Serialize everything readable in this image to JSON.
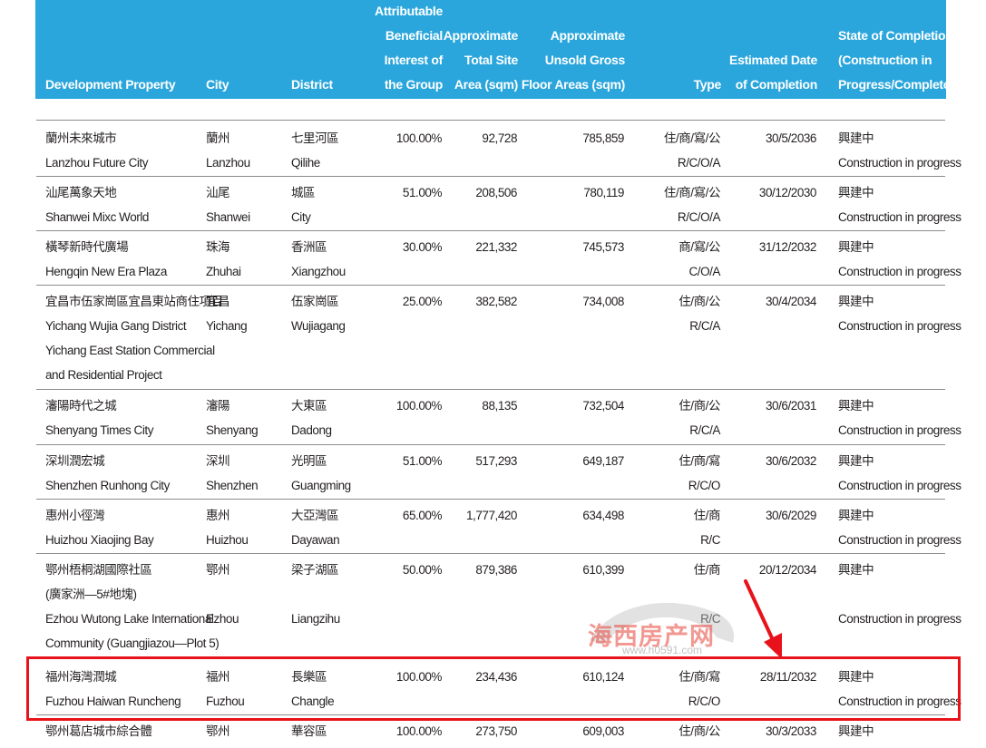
{
  "headers": {
    "property": "Development Property",
    "city": "City",
    "district": "District",
    "interest": "Attributable\nBeneficial\nInterest of\nthe Group",
    "site_area": "Approximate\nTotal Site\nArea (sqm)",
    "gfa": "Approximate\nUnsold Gross\nFloor Areas (sqm)",
    "type": "Type",
    "completion_date": "Estimated Date\nof Completion",
    "state": "State of Completion\n(Construction in\nProgress/Completed)"
  },
  "rows": [
    {
      "prop_zh": "蘭州未來城市",
      "prop_en": "Lanzhou Future City",
      "city_zh": "蘭州",
      "city_en": "Lanzhou",
      "dist_zh": "七里河區",
      "dist_en": "Qilihe",
      "interest": "100.00%",
      "site": "92,728",
      "gfa": "785,859",
      "type_zh": "住/商/寫/公",
      "type_en": "R/C/O/A",
      "date": "30/5/2036",
      "state_zh": "興建中",
      "state_en": "Construction in progress"
    },
    {
      "prop_zh": "汕尾萬象天地",
      "prop_en": "Shanwei Mixc World",
      "city_zh": "汕尾",
      "city_en": "Shanwei",
      "dist_zh": "城區",
      "dist_en": "City",
      "interest": "51.00%",
      "site": "208,506",
      "gfa": "780,119",
      "type_zh": "住/商/寫/公",
      "type_en": "R/C/O/A",
      "date": "30/12/2030",
      "state_zh": "興建中",
      "state_en": "Construction in progress"
    },
    {
      "prop_zh": "橫琴新時代廣場",
      "prop_en": "Hengqin New Era Plaza",
      "city_zh": "珠海",
      "city_en": "Zhuhai",
      "dist_zh": "香洲區",
      "dist_en": "Xiangzhou",
      "interest": "30.00%",
      "site": "221,332",
      "gfa": "745,573",
      "type_zh": "商/寫/公",
      "type_en": "C/O/A",
      "date": "31/12/2032",
      "state_zh": "興建中",
      "state_en": "Construction in progress"
    },
    {
      "prop_zh": "宜昌市伍家崗區宜昌東站商住項目",
      "prop_en": "Yichang Wujia Gang District\n    Yichang East Station Commercial\n    and Residential Project",
      "city_zh": "宜昌",
      "city_en": "Yichang",
      "dist_zh": "伍家崗區",
      "dist_en": "Wujiagang",
      "interest": "25.00%",
      "site": "382,582",
      "gfa": "734,008",
      "type_zh": "住/商/公",
      "type_en": "R/C/A",
      "date": "30/4/2034",
      "state_zh": "興建中",
      "state_en": "Construction in progress"
    },
    {
      "prop_zh": "瀋陽時代之城",
      "prop_en": "Shenyang Times City",
      "city_zh": "瀋陽",
      "city_en": "Shenyang",
      "dist_zh": "大東區",
      "dist_en": "Dadong",
      "interest": "100.00%",
      "site": "88,135",
      "gfa": "732,504",
      "type_zh": "住/商/公",
      "type_en": "R/C/A",
      "date": "30/6/2031",
      "state_zh": "興建中",
      "state_en": "Construction in progress"
    },
    {
      "prop_zh": "深圳潤宏城",
      "prop_en": "Shenzhen Runhong City",
      "city_zh": "深圳",
      "city_en": "Shenzhen",
      "dist_zh": "光明區",
      "dist_en": "Guangming",
      "interest": "51.00%",
      "site": "517,293",
      "gfa": "649,187",
      "type_zh": "住/商/寫",
      "type_en": "R/C/O",
      "date": "30/6/2032",
      "state_zh": "興建中",
      "state_en": "Construction in progress"
    },
    {
      "prop_zh": "惠州小徑灣",
      "prop_en": "Huizhou Xiaojing Bay",
      "city_zh": "惠州",
      "city_en": "Huizhou",
      "dist_zh": "大亞灣區",
      "dist_en": "Dayawan",
      "interest": "65.00%",
      "site": "1,777,420",
      "gfa": "634,498",
      "type_zh": "住/商",
      "type_en": "R/C",
      "date": "30/6/2029",
      "state_zh": "興建中",
      "state_en": "Construction in progress"
    },
    {
      "prop_zh": "鄂州梧桐湖國際社區\n(廣家洲—5#地塊)",
      "prop_en": "Ezhou Wutong Lake International\n    Community (Guangjiazou—Plot 5)",
      "city_zh": "鄂州",
      "city_en": "Ezhou",
      "dist_zh": "梁子湖區",
      "dist_en": "Liangzihu",
      "interest": "50.00%",
      "site": "879,386",
      "gfa": "610,399",
      "type_zh": "住/商",
      "type_en": "R/C",
      "date": "20/12/2034",
      "state_zh": "興建中",
      "state_en": "Construction in progress"
    },
    {
      "prop_zh": "福州海灣潤城",
      "prop_en": "Fuzhou Haiwan Runcheng",
      "city_zh": "福州",
      "city_en": "Fuzhou",
      "dist_zh": "長樂區",
      "dist_en": "Changle",
      "interest": "100.00%",
      "site": "234,436",
      "gfa": "610,124",
      "type_zh": "住/商/寫",
      "type_en": "R/C/O",
      "date": "28/11/2032",
      "state_zh": "興建中",
      "state_en": "Construction in progress"
    },
    {
      "prop_zh": "鄂州葛店城市綜合體",
      "prop_en": "",
      "city_zh": "鄂州",
      "city_en": "",
      "dist_zh": "華容區",
      "dist_en": "",
      "interest": "100.00%",
      "site": "273,750",
      "gfa": "609,003",
      "type_zh": "住/商/公",
      "type_en": "",
      "date": "30/3/2033",
      "state_zh": "興建中",
      "state_en": ""
    }
  ],
  "watermark": {
    "text": "海西房产网",
    "url": "www.h0591.com"
  },
  "colors": {
    "header_bg": "#2aa6dc",
    "highlight": "#e8121b",
    "watermark": "#e8443a"
  }
}
